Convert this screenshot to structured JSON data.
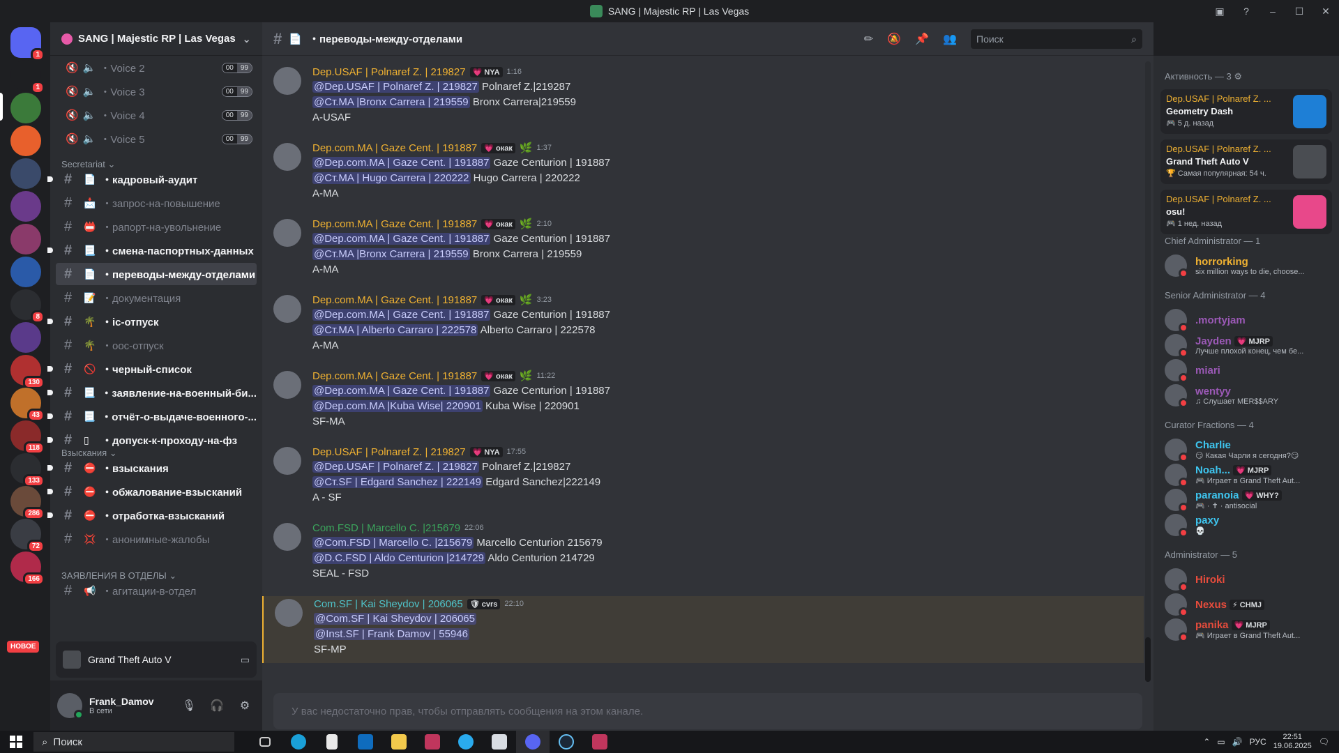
{
  "window": {
    "title": "SANG | Majestic RP | Las Vegas"
  },
  "guilds": [
    {
      "badge": "1"
    },
    {
      "badge": "1"
    },
    {
      "badge": ""
    },
    {
      "badge": ""
    },
    {
      "badge": ""
    },
    {
      "badge": ""
    },
    {
      "badge": ""
    },
    {
      "badge": ""
    },
    {
      "badge": "8"
    },
    {
      "badge": ""
    },
    {
      "badge": "130"
    },
    {
      "badge": "43"
    },
    {
      "badge": "118"
    },
    {
      "badge": "133"
    },
    {
      "badge": "286"
    },
    {
      "badge": "72"
    },
    {
      "badge": "166"
    }
  ],
  "new_badge": "НОВОЕ",
  "server": {
    "name": "SANG | Majestic RP | Las Vegas"
  },
  "voice_channels": [
    {
      "name": "・Voice 2",
      "count": "00",
      "limit": "99"
    },
    {
      "name": "・Voice 3",
      "count": "00",
      "limit": "99"
    },
    {
      "name": "・Voice 4",
      "count": "00",
      "limit": "99"
    },
    {
      "name": "・Voice 5",
      "count": "00",
      "limit": "99"
    }
  ],
  "categories": {
    "secretariat": "Secretariat",
    "penalties": "Взыскания",
    "applications": "ЗАЯВЛЕНИЯ В ОТДЕЛЫ"
  },
  "channels": [
    {
      "emoji": "📄",
      "name": "・кадровый-аудит",
      "state": "unread"
    },
    {
      "emoji": "📩",
      "name": "・запрос-на-повышение",
      "state": "read"
    },
    {
      "emoji": "📛",
      "name": "・рапорт-на-увольнение",
      "state": "read"
    },
    {
      "emoji": "📃",
      "name": "・смена-паспортных-данных",
      "state": "unread"
    },
    {
      "emoji": "📄",
      "name": "・переводы-между-отделами",
      "state": "active"
    },
    {
      "emoji": "📝",
      "name": "・документация",
      "state": "read"
    },
    {
      "emoji": "🌴",
      "name": "・ic-отпуск",
      "state": "unread"
    },
    {
      "emoji": "🌴",
      "name": "・оос-отпуск",
      "state": "read"
    },
    {
      "emoji": "🚫",
      "name": "・черный-список",
      "state": "unread"
    },
    {
      "emoji": "📃",
      "name": "・заявление-на-военный-би...",
      "state": "unread"
    },
    {
      "emoji": "📃",
      "name": "・отчёт-о-выдаче-военного-...",
      "state": "unread"
    },
    {
      "emoji": "▯",
      "name": "・допуск-к-проходу-на-фз",
      "state": "unread"
    }
  ],
  "penalty_channels": [
    {
      "emoji": "⛔",
      "name": "・взыскания",
      "state": "unread"
    },
    {
      "emoji": "⛔",
      "name": "・обжалование-взысканий",
      "state": "unread"
    },
    {
      "emoji": "⛔",
      "name": "・отработка-взысканий",
      "state": "unread"
    },
    {
      "emoji": "💢",
      "name": "・анонимные-жалобы",
      "state": "read"
    }
  ],
  "application_channels": [
    {
      "emoji": "📢",
      "name": "・агитации-в-отдел",
      "state": "read"
    }
  ],
  "activity": {
    "game": "Grand Theft Auto V"
  },
  "user": {
    "name": "Frank_Damov",
    "status": "В сети"
  },
  "channel": {
    "name": "・переводы-между-отделами",
    "search_placeholder": "Поиск"
  },
  "messages": [
    {
      "author": "Dep.USAF | Polnaref Z. | 219827",
      "color": "#f0b232",
      "tag": "💗 NYA",
      "time": "1:16",
      "lines": [
        {
          "mention": "@Dep.USAF | Polnaref Z. | 219827",
          "text": " Polnaref Z.|219287"
        },
        {
          "mention": "@Ст.MA |Bronx Carrera | 219559",
          "text": " Bronx Carrera|219559"
        },
        {
          "mention": "",
          "text": "A-USAF"
        }
      ]
    },
    {
      "author": "Dep.com.MA | Gaze Cent. | 191887",
      "color": "#f0b232",
      "tag": "💗 окак",
      "time": "1:37",
      "lines": [
        {
          "mention": "@Dep.com.MA | Gaze Cent. | 191887",
          "text": " Gaze Centurion | 191887"
        },
        {
          "mention": "@Ст.MA | Hugo Carrera | 220222",
          "text": " Hugo Carrera | 220222"
        },
        {
          "mention": "",
          "text": "A-MA"
        }
      ]
    },
    {
      "author": "Dep.com.MA | Gaze Cent. | 191887",
      "color": "#f0b232",
      "tag": "💗 окак",
      "time": "2:10",
      "lines": [
        {
          "mention": "@Dep.com.MA | Gaze Cent. | 191887",
          "text": " Gaze Centurion | 191887"
        },
        {
          "mention": "@Ст.MA |Bronx Carrera | 219559",
          "text": " Bronx Carrera | 219559"
        },
        {
          "mention": "",
          "text": "A-MA"
        }
      ]
    },
    {
      "author": "Dep.com.MA | Gaze Cent. | 191887",
      "color": "#f0b232",
      "tag": "💗 окак",
      "time": "3:23",
      "lines": [
        {
          "mention": "@Dep.com.MA | Gaze Cent. | 191887",
          "text": " Gaze Centurion | 191887"
        },
        {
          "mention": "@Ст.MA | Alberto Carraro | 222578",
          "text": " Alberto Carraro | 222578"
        },
        {
          "mention": "",
          "text": "A-MA"
        }
      ]
    },
    {
      "author": "Dep.com.MA | Gaze Cent. | 191887",
      "color": "#f0b232",
      "tag": "💗 окак",
      "time": "11:22",
      "lines": [
        {
          "mention": "@Dep.com.MA | Gaze Cent. | 191887",
          "text": " Gaze Centurion | 191887"
        },
        {
          "mention": "@Dep.com.MA |Kuba Wise| 220901",
          "text": " Kuba Wise | 220901"
        },
        {
          "mention": "",
          "text": "SF-MA"
        }
      ]
    },
    {
      "author": "Dep.USAF | Polnaref Z. | 219827",
      "color": "#f0b232",
      "tag": "💗 NYA",
      "time": "17:55",
      "lines": [
        {
          "mention": "@Dep.USAF | Polnaref Z. | 219827",
          "text": " Polnaref Z.|219827"
        },
        {
          "mention": "@Ст.SF | Edgard Sanchez | 222149",
          "text": " Edgard Sanchez|222149"
        },
        {
          "mention": "",
          "text": "A - SF"
        }
      ]
    },
    {
      "author": "Com.FSD | Marcello C. |215679",
      "color": "#3ba55c",
      "tag": "",
      "time": "22:06",
      "lines": [
        {
          "mention": "@Com.FSD | Marcello C. |215679",
          "text": " Marcello Centurion 215679"
        },
        {
          "mention": "@D.C.FSD | Aldo Centurion |214729",
          "text": " Aldo Centurion 214729"
        },
        {
          "mention": "",
          "text": "SEAL - FSD"
        }
      ]
    },
    {
      "author": "Com.SF | Kai Sheydov | 206065",
      "color": "#4fc3c9",
      "tag": "🛡 cvrs",
      "time": "22:10",
      "lines": [
        {
          "mention": "@Com.SF | Kai Sheydov | 206065",
          "text": ""
        },
        {
          "mention": "@Inst.SF | Frank Damov | 55946",
          "text": ""
        },
        {
          "mention": "",
          "text": "SF-MP"
        }
      ]
    }
  ],
  "composer": {
    "text": "У вас недостаточно прав, чтобы отправлять сообщения на этом канале."
  },
  "members": {
    "activity_header": "Активность — 3",
    "activities": [
      {
        "who": "Dep.USAF | Polnaref Z. ...",
        "game": "Geometry Dash",
        "sub": "🎮 5 д. назад",
        "icon_color": "#1e7fd6"
      },
      {
        "who": "Dep.USAF | Polnaref Z. ...",
        "game": "Grand Theft Auto V",
        "sub": "🏆 Самая популярная: 54 ч.",
        "icon_color": "#4a4d52"
      },
      {
        "who": "Dep.USAF | Polnaref Z. ...",
        "game": "osu!",
        "sub": "🎮 1 нед. назад",
        "icon_color": "#e8488a"
      }
    ],
    "groups": [
      {
        "title": "Chief Administrator — 1",
        "members": [
          {
            "name": "horrorking",
            "color": "#f0b232",
            "status": "six million ways to die, choose..."
          }
        ]
      },
      {
        "title": "Senior Administrator — 4",
        "members": [
          {
            "name": ".mortyjam",
            "color": "#9b59b6",
            "tag": "",
            "status": ""
          },
          {
            "name": "Jayden",
            "color": "#9b59b6",
            "tag": "💗 MJRP",
            "status": "Лучше плохой конец, чем бе..."
          },
          {
            "name": "miari",
            "color": "#9b59b6",
            "tag": "",
            "status": ""
          },
          {
            "name": "wentyy",
            "color": "#9b59b6",
            "tag": "",
            "status": "♫ Слушает MER$$ARY"
          }
        ]
      },
      {
        "title": "Curator Fractions — 4",
        "members": [
          {
            "name": "Charlie",
            "color": "#3ec6f0",
            "tag": "",
            "status": "😏 Какая Чарли я сегодня?😏"
          },
          {
            "name": "Noah...",
            "color": "#3ec6f0",
            "tag": "💗 MJRP",
            "status": "🎮 Играет в Grand Theft Aut..."
          },
          {
            "name": "paranoia",
            "color": "#3ec6f0",
            "tag": "💗 WHY?",
            "status": "🎮 · ✝ · antisocial"
          },
          {
            "name": "paxy",
            "color": "#3ec6f0",
            "tag": "",
            "status": "💀"
          }
        ]
      },
      {
        "title": "Administrator — 5",
        "members": [
          {
            "name": "Hiroki",
            "color": "#e74c3c",
            "tag": "",
            "status": ""
          },
          {
            "name": "Nexus",
            "color": "#e74c3c",
            "tag": "⚡ CHMJ",
            "status": ""
          },
          {
            "name": "panika",
            "color": "#e74c3c",
            "tag": "💗 MJRP",
            "status": "🎮 Играет в Grand Theft Aut..."
          }
        ]
      }
    ]
  },
  "taskbar": {
    "search": "Поиск",
    "lang": "РУС",
    "time": "22:51",
    "date": "19.06.2025"
  }
}
